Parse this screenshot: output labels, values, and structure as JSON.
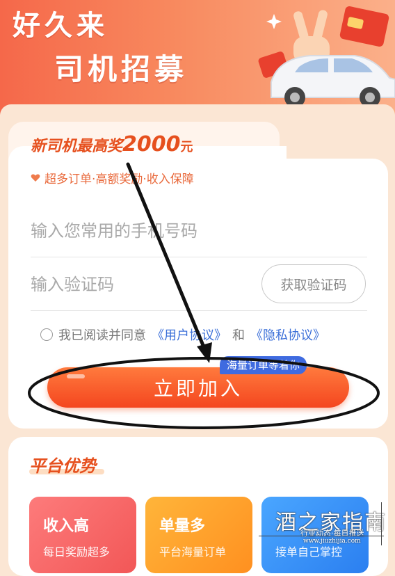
{
  "banner": {
    "title_line1": "好久来",
    "title_line2": "司机招募"
  },
  "form": {
    "headline_prefix": "新司机最高奖",
    "headline_amount": "2000",
    "headline_unit": "元",
    "subtitle": "超多订单·高额奖励·收入保障",
    "phone_placeholder": "输入您常用的手机号码",
    "phone_value": "",
    "code_placeholder": "输入验证码",
    "code_value": "",
    "get_code_label": "获取验证码",
    "agree_text": "我已阅读并同意",
    "user_agreement": "《用户协议》",
    "and_text": "和",
    "privacy_policy": "《隐私协议》",
    "join_label": "立即加入",
    "badge_text": "海量订单等着你"
  },
  "advantages": {
    "title": "平台优势",
    "tiles": [
      {
        "title": "收入高",
        "desc": "每日奖励超多"
      },
      {
        "title": "单量多",
        "desc": "平台海量订单"
      },
      {
        "title": "",
        "desc": "接单自己掌控"
      }
    ]
  },
  "watermark": {
    "main": "酒之家指南",
    "sub": "行业动态·每日推送",
    "url": "www.jiuzhijia.com"
  },
  "colors": {
    "accent": "#f4461f",
    "headline": "#e6501e",
    "link": "#3b6fd8",
    "badge": "#3f6be0"
  },
  "icons": {
    "subtitle_icon": "heart-icon",
    "annotation": "arrow-and-ellipse-annotation"
  }
}
